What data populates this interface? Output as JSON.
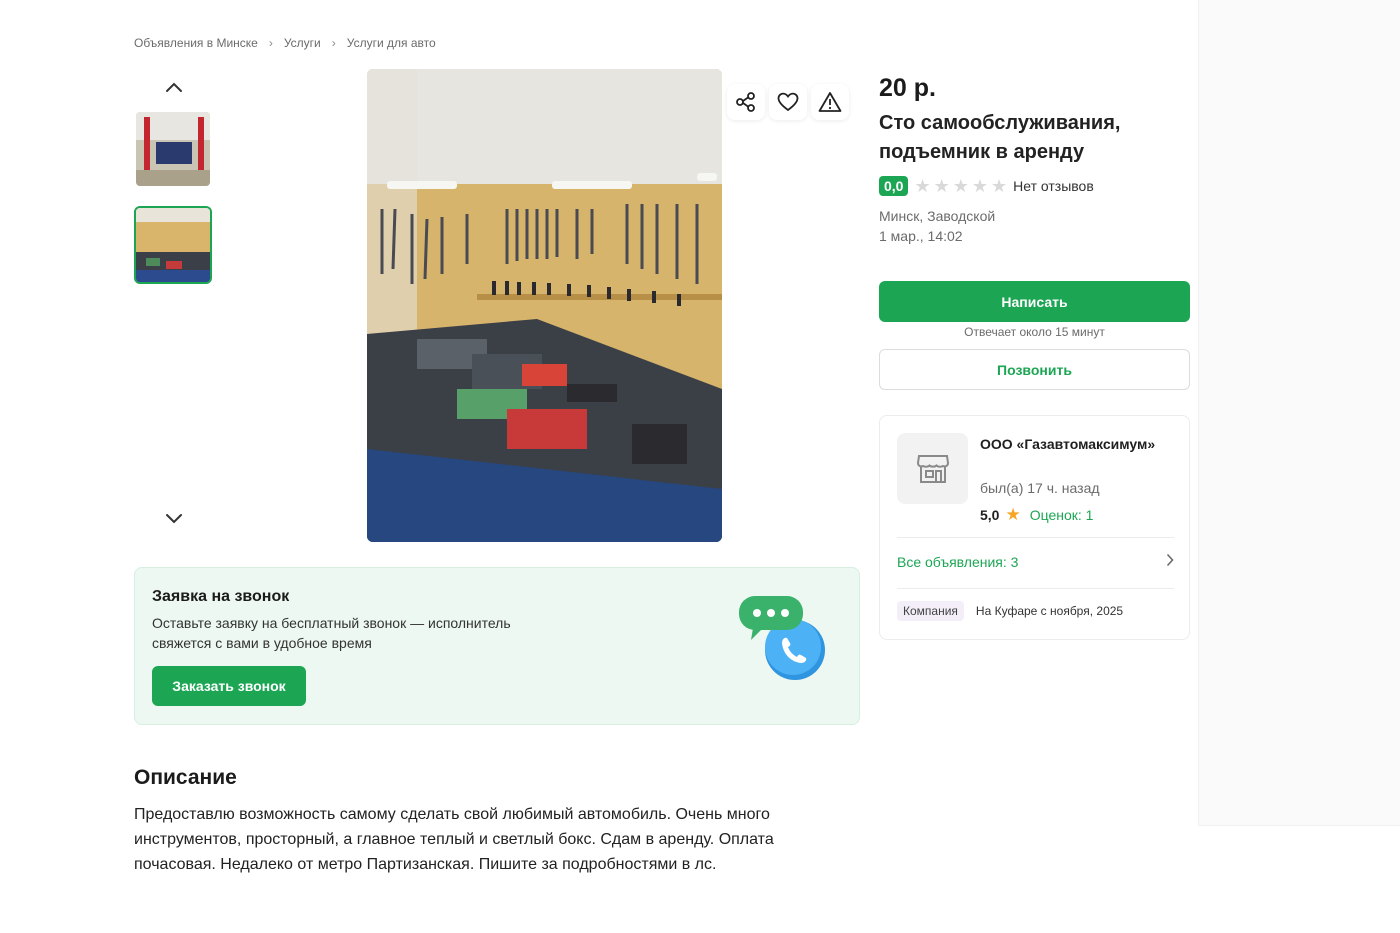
{
  "breadcrumb": [
    "Объявления в Минске",
    "Услуги",
    "Услуги для авто"
  ],
  "listing": {
    "price": "20 р.",
    "title": "Сто самообслуживания, подъемник в аренду",
    "rating": "0,0",
    "reviews_text": "Нет отзывов",
    "location": "Минск, Заводской",
    "date": "1 мар., 14:02"
  },
  "actions": {
    "write_label": "Написать",
    "reply_note": "Отвечает около 15 минут",
    "call_label": "Позвонить"
  },
  "seller": {
    "name": "ООО «Газавтомаксимум»",
    "last_seen": "был(а) 17 ч. назад",
    "rating": "5,0",
    "ratings_count": "Оценок: 1",
    "all_ads": "Все объявления: 3",
    "tag": "Компания",
    "since": "На Куфаре с ноября, 2025"
  },
  "callback": {
    "title": "Заявка на звонок",
    "text": "Оставьте заявку на бесплатный звонок — исполнитель свяжется с вами в удобное время",
    "button": "Заказать звонок"
  },
  "description": {
    "title": "Описание",
    "text": "Предоставлю возможность самому сделать свой любимый автомобиль. Очень много инструментов, просторный, а главное теплый и светлый бокс. Сдам в аренду. Оплата почасовая. Недалеко от метро Партизанская. Пишите за подробностями в лс."
  },
  "icons": {
    "share": "share-icon",
    "favorite": "heart-icon",
    "report": "warning-icon",
    "up": "chevron-up-icon",
    "down": "chevron-down-icon",
    "shop": "shop-icon",
    "chat_phone": "chat-phone-icon"
  },
  "colors": {
    "accent": "#1ca654",
    "star_yellow": "#f5a623",
    "callback_bg": "#edf8f2"
  }
}
